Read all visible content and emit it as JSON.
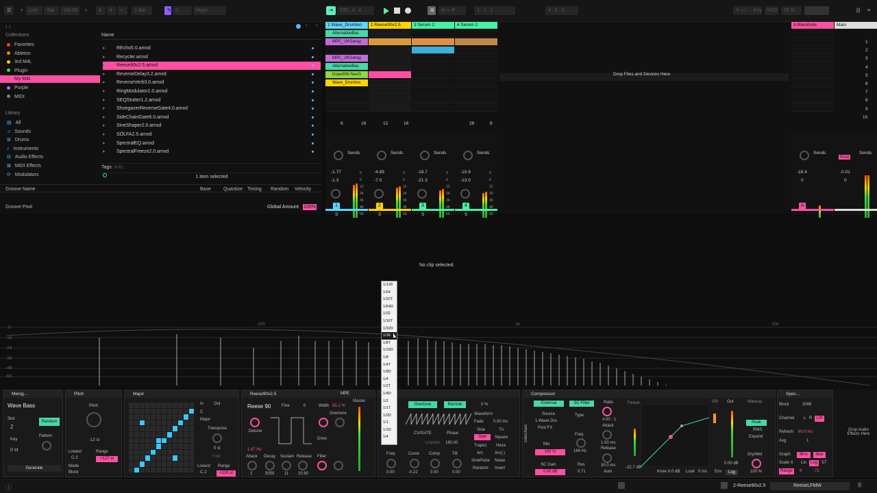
{
  "transport": {
    "link": "Link",
    "tap": "Tap",
    "tempo": "140.00",
    "sig_num": "4",
    "sig_den": "4",
    "quant": "1 Bar",
    "scale_key": "C",
    "scale_mode": "Major",
    "position": "235 . 4 . 4",
    "loop_start": "1 . 1 . 1",
    "loop_len": "4 . 0 . 0",
    "key_label": "Key",
    "midi_label": "MIDI",
    "cpu": "29 %"
  },
  "browser": {
    "collections_title": "Collections",
    "collections": [
      {
        "label": "Favorites",
        "color": "#ff3b3b"
      },
      {
        "label": "Ableton",
        "color": "#ff8a00"
      },
      {
        "label": "3rd M4L",
        "color": "#ffd400"
      },
      {
        "label": "Plugin",
        "color": "#48d848"
      },
      {
        "label": "My M4L",
        "color": "#ff4fa3"
      },
      {
        "label": "Purple",
        "color": "#b36bff"
      },
      {
        "label": "MIDI",
        "color": "#7f7f7f"
      }
    ],
    "library_title": "Library",
    "library": [
      "All",
      "Sounds",
      "Drums",
      "Instruments",
      "Audio Effects",
      "MIDI Effects",
      "Modulators"
    ],
    "name_header": "Name",
    "files": [
      "REcho5.0.amxd",
      "Recycler.amxd",
      "Reese90v2.5.amxd",
      "ReverseDelay3.2.amxd",
      "ReverseVerb3.0.amxd",
      "RingModulator1.0.amxd",
      "SEQStutter1.2.amxd",
      "ShoegazerReverseGate4.0.amxd",
      "SideChainGate6.0.amxd",
      "SineShaper2.0.amxd",
      "SOLFA2.5.amxd",
      "SpectralEQ.amxd",
      "SpectralFreeze2.0.amxd"
    ],
    "selected_file": "Reese90v2.5.amxd",
    "tags_label": "Tags:",
    "tags_add": "Add...",
    "status": "1 item selected"
  },
  "groove": {
    "name": "Groove Name",
    "base": "Base",
    "quantize": "Quantize",
    "timing": "Timing",
    "random": "Random",
    "velocity": "Velocity",
    "pool": "Groove Pool",
    "global": "Global Amount",
    "global_val": "100%"
  },
  "session": {
    "tracks": [
      {
        "name": "1 Wave_Drumloo",
        "color": "#5bd6ff"
      },
      {
        "name": "2 Reese90v2.5",
        "color": "#ffd400"
      },
      {
        "name": "3 Serum 2",
        "color": "#48f0a4"
      },
      {
        "name": "4 Serum 2",
        "color": "#48f0a4"
      }
    ],
    "return_a": "A Blackhole",
    "main": "Main",
    "clips_t1": [
      {
        "name": "AlternativeBas",
        "color": "#48d8a8"
      },
      {
        "name": "MPC_UKGarag",
        "color": "#c46bd8"
      },
      {
        "name": "",
        "color": ""
      },
      {
        "name": "MPC_UKGarag",
        "color": "#c46bd8"
      },
      {
        "name": "AlternativeBas",
        "color": "#48d8a8"
      },
      {
        "name": "Dope808-NeoG",
        "color": "#8fd83f"
      },
      {
        "name": "Wave_Drumloo",
        "color": "#ffd400"
      }
    ],
    "drop_text": "Drop Files and Devices Here",
    "scenes": [
      "1",
      "2",
      "3",
      "4",
      "5",
      "6",
      "7",
      "8",
      "9",
      "10"
    ],
    "sends": "Sends",
    "post": "Post",
    "vols": [
      {
        "vol": "-1.77",
        "pk": "-1.3",
        "num": "1",
        "s": "S"
      },
      {
        "vol": "-4.89",
        "pk": "-7.0",
        "num": "2",
        "s": "S"
      },
      {
        "vol": "-18.7",
        "pk": "-21.3",
        "num": "3",
        "s": "S"
      },
      {
        "vol": "-10.9",
        "pk": "-13.0",
        "num": "4",
        "s": "S"
      }
    ],
    "ret_vol": "-18.4",
    "ret_pk": "0",
    "ret_num": "A",
    "main_vol": "-0.01",
    "main_pk": "0",
    "counts": [
      "6",
      "16",
      "12",
      "16",
      "28",
      "8"
    ],
    "scale": [
      "0",
      "6",
      "12",
      "24",
      "36",
      "48",
      "60"
    ]
  },
  "detail": {
    "no_clip": "No clip selected."
  },
  "spectrum": {
    "freq_labels": [
      "100",
      "1k",
      "10k"
    ],
    "db_labels": [
      "0",
      "-12",
      "-24",
      "-36",
      "-48",
      "-60"
    ]
  },
  "quant_menu": [
    "1/128",
    "1/64",
    "1/32T",
    "1/64D",
    "1/32",
    "1/16T",
    "1/32D",
    "1/16",
    "1/8T",
    "1/16D",
    "1/8",
    "1/4T",
    "1/8D",
    "1/4",
    "1/2T",
    "1/4D",
    "1/2",
    "1/1T",
    "1/2D",
    "1/1",
    "1/1D",
    "1/4"
  ],
  "quant_selected": "1/16",
  "devices": {
    "melog": {
      "title": "Melog...",
      "preset": "Wave Bass",
      "slot": "Slot",
      "slot_val": "2",
      "random": "Random",
      "key": "Key",
      "key_val": "0 st",
      "pattern": "Pattern",
      "generate": "Generate"
    },
    "pitch": {
      "title": "Pitch",
      "pitch": "Pitch",
      "st": "-12 st",
      "lowest": "Lowest",
      "lowest_val": "C-2",
      "range": "Range",
      "range_val": "+127 st",
      "mode": "Mode",
      "mode_val": "Block"
    },
    "major": {
      "title": "Major",
      "in": "In",
      "out": "Out",
      "key": "C",
      "mode": "Major",
      "transpose": "Transpose",
      "tr_val": "0 st",
      "fold": "Fold",
      "lowest": "Lowest",
      "lowest_val": "C-2",
      "range": "Range",
      "range_val": "+128 st"
    },
    "reese": {
      "title": "Reese90v2.5",
      "preset": "Reese 90",
      "fine": "Fine",
      "fine_val": "0",
      "width": "Width",
      "width_val": "55.1 %",
      "overtone": "Overtone",
      "detune": "Detune",
      "hz": "1.67 Hz",
      "attack": "Attack",
      "decay": "Decay",
      "sustain": "Sustain",
      "release": "Release",
      "drive": "Drive",
      "filter": "Filter",
      "a": "2",
      "d": "5059",
      "s": "11",
      "r": "20.60",
      "master": "Master",
      "mpe": "MPE"
    },
    "lfo": {
      "title": "...8",
      "overtone": "Overtone",
      "remote": "Remote",
      "pct": "0 %",
      "cv": "CV/GATE",
      "phase": "Phase",
      "unipolar": "Unipolar",
      "deg": "180.00",
      "waveform": "Waveform",
      "fade": "Fade",
      "fade_val": "0.00 ms",
      "sine": "Sine",
      "tri": "Tri",
      "saw": "Saw",
      "square": "Square",
      "trapez": "Trapez",
      "hexa": "Hexa",
      "arc": "Arc",
      "arc2": "Arc(-)",
      "sinepulse": "SinePulse",
      "noise": "Noise",
      "random": "Random",
      "invert": "Invert",
      "freq": "Freq",
      "curve": "Curve",
      "comp": "Comp",
      "tilt": "Tilt",
      "v1": "0.00",
      "v2": "-0.22",
      "v3": "0.00",
      "v4": "0.00"
    },
    "comp": {
      "title": "Compressor",
      "external": "External",
      "scfilter": "SC Filter",
      "source": "Source",
      "src_val": "1-Wave Dru",
      "postfx": "Post FX",
      "type": "Type",
      "freq": "Freq",
      "freq_val": "164 Hz",
      "ratio": "Ratio",
      "ratio_val": "4.00 : 1",
      "attack": "Attack",
      "att_val": "1.00 ms",
      "release": "Release",
      "rel_val": "30.0 ms",
      "auto": "Auto",
      "mix": "Mix",
      "mix_val": "100 %",
      "scgain": "SC Gain",
      "scgain_val": "0.00 dB",
      "res": "Res",
      "res_val": "0.71",
      "thresh": "Thresh",
      "gr": "GR",
      "out": "Out",
      "makeup": "Makeup",
      "peak": "Peak",
      "rms": "RMS",
      "expand": "Expand",
      "drywet": "Dry/Wet",
      "dw_val": "100 %",
      "knee": "Knee",
      "knee_val": "6.0 dB",
      "look": "Look",
      "look_val": "0 ms",
      "env": "Env",
      "log": "Log",
      "db1": "-22.7 dB",
      "db2": "0.00 dB",
      "sidechain": "Sidechain"
    },
    "spec": {
      "title": "Spec...",
      "block": "Block",
      "block_val": "2048",
      "channel": "Channel",
      "l": "L",
      "r": "R",
      "lr": "L/R",
      "refresh": "Refresh",
      "ref_val": "60.0 ms",
      "avg": "Avg",
      "avg_val": "1",
      "graph": "Graph",
      "bins": "Bins",
      "max": "Max",
      "scalex": "Scale X",
      "lin": "Lin",
      "log": "Log",
      "st": "ST",
      "range": "Range",
      "r1": "6",
      "r2": "-72"
    },
    "drop": "Drop Audio Effects Here"
  },
  "statusbar": {
    "track": "2-Reese90v2.5",
    "device": "ReeseLFMW"
  }
}
